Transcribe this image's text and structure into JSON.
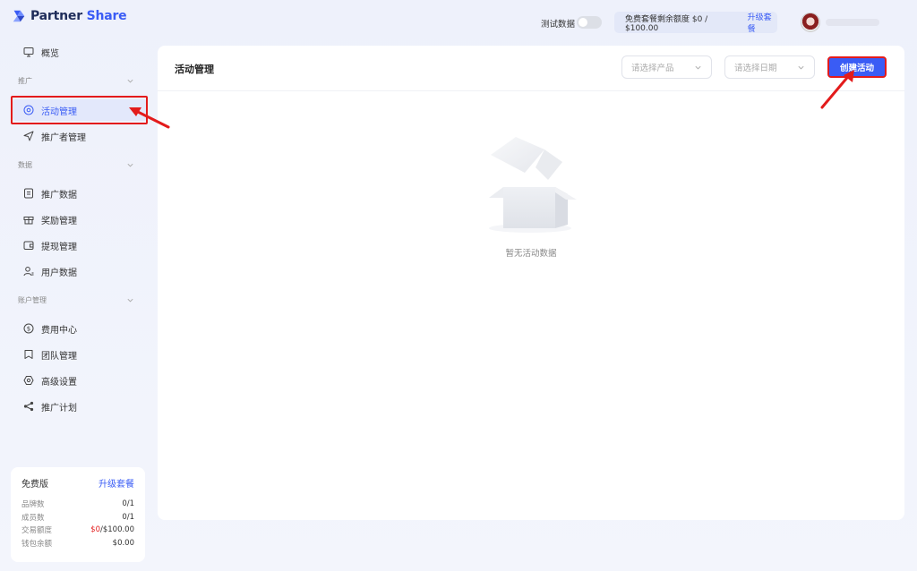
{
  "brand": {
    "name_part1": "Partner ",
    "name_part2": "Share"
  },
  "sidebar": {
    "overview": "概览",
    "groups": [
      {
        "label": "推广"
      },
      {
        "label": "数据"
      },
      {
        "label": "账户管理"
      }
    ],
    "items": [
      {
        "label": "活动管理",
        "icon": "target-icon",
        "active": true
      },
      {
        "label": "推广者管理",
        "icon": "send-icon"
      },
      {
        "label": "推广数据",
        "icon": "document-icon"
      },
      {
        "label": "奖励管理",
        "icon": "gift-icon"
      },
      {
        "label": "提现管理",
        "icon": "wallet-icon"
      },
      {
        "label": "用户数据",
        "icon": "user-icon"
      },
      {
        "label": "费用中心",
        "icon": "dollar-icon"
      },
      {
        "label": "团队管理",
        "icon": "bookmark-icon"
      },
      {
        "label": "高级设置",
        "icon": "hexagon-icon"
      },
      {
        "label": "推广计划",
        "icon": "share-icon"
      }
    ],
    "plan": {
      "name": "免费版",
      "upgrade": "升级套餐",
      "rows": [
        {
          "label": "品牌数",
          "value": "0/1"
        },
        {
          "label": "成员数",
          "value": "0/1"
        },
        {
          "label": "交易额度",
          "value_red": "$0",
          "value": "/$100.00"
        },
        {
          "label": "钱包余额",
          "value": "$0.00"
        }
      ]
    }
  },
  "topbar": {
    "test_data_label": "测试数据",
    "quota_text": "免费套餐剩余额度 $0 / $100.00",
    "upgrade": "升级套餐"
  },
  "main": {
    "title": "活动管理",
    "product_select_placeholder": "请选择产品",
    "date_select_placeholder": "请选择日期",
    "create_button": "创建活动",
    "empty_text": "暂无活动数据"
  },
  "colors": {
    "accent": "#3a5cf5",
    "annotation_red": "#e31b1b"
  }
}
